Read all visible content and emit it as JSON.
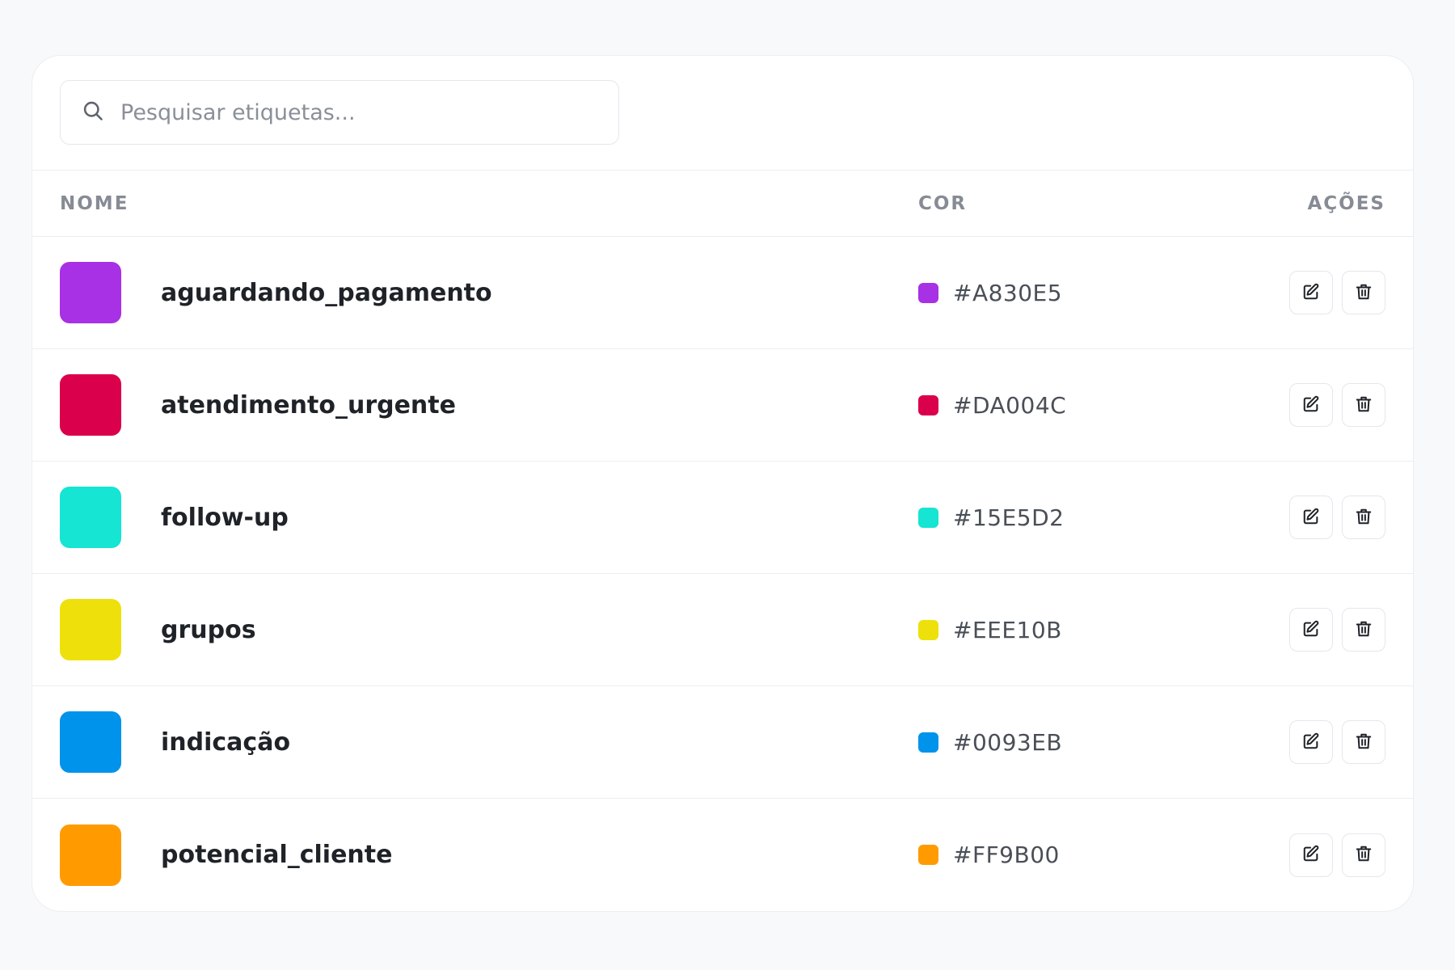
{
  "search": {
    "placeholder": "Pesquisar etiquetas...",
    "value": ""
  },
  "table": {
    "headers": {
      "name": "NOME",
      "color": "COR",
      "actions": "AÇÕES"
    },
    "rows": [
      {
        "name": "aguardando_pagamento",
        "hex": "#A830E5",
        "color": "#A830E5"
      },
      {
        "name": "atendimento_urgente",
        "hex": "#DA004C",
        "color": "#DA004C"
      },
      {
        "name": "follow-up",
        "hex": "#15E5D2",
        "color": "#15E5D2"
      },
      {
        "name": "grupos",
        "hex": "#EEE10B",
        "color": "#EEE10B"
      },
      {
        "name": "indicação",
        "hex": "#0093EB",
        "color": "#0093EB"
      },
      {
        "name": "potencial_cliente",
        "hex": "#FF9B00",
        "color": "#FF9B00"
      }
    ]
  },
  "icons": {
    "search": "search-icon",
    "edit": "edit-icon",
    "delete": "trash-icon"
  }
}
